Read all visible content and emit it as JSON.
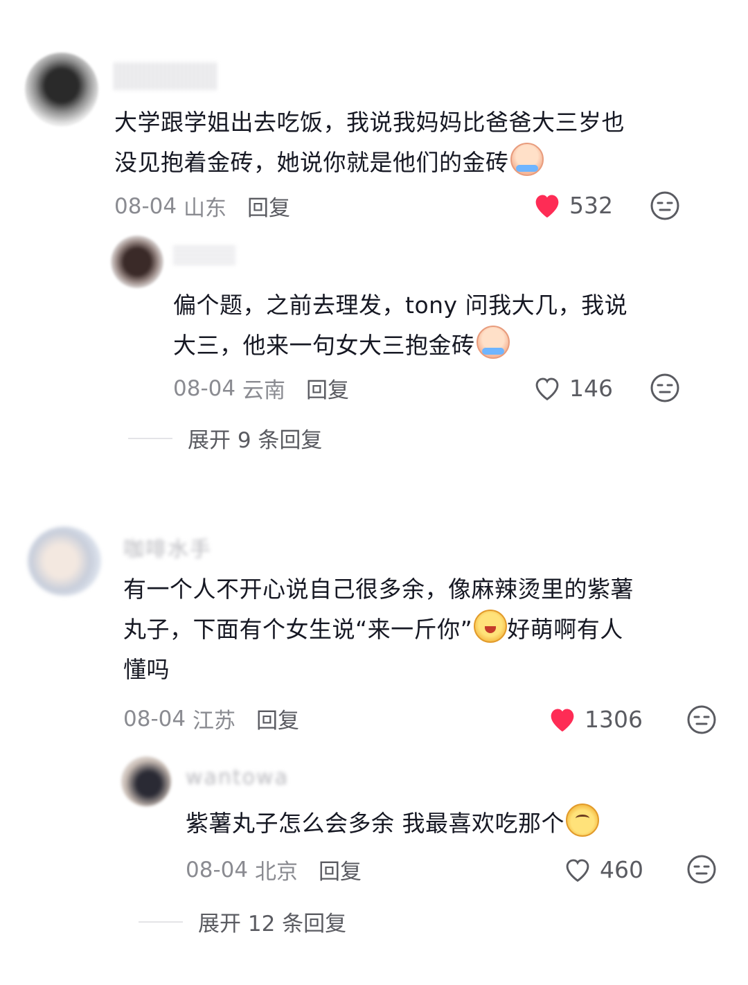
{
  "comments": [
    {
      "text_line1": "大学跟学姐出去吃饭，我说我妈妈比爸爸大三岁也",
      "text_line2": "没见抱着金砖，她说你就是他们的金砖",
      "date": "08-04",
      "location": "山东",
      "reply_label": "回复",
      "likes": "532",
      "liked": true,
      "replies": [
        {
          "text_line1": "偏个题，之前去理发，tony 问我大几，我说",
          "text_line2": "大三，他来一句女大三抱金砖",
          "date": "08-04",
          "location": "云南",
          "reply_label": "回复",
          "likes": "146",
          "liked": false
        }
      ],
      "expand_label": "展开 9 条回复"
    },
    {
      "username": "咖啡水手",
      "text_line1": "有一个人不开心说自己很多余，像麻辣烫里的紫薯",
      "text_line2a": "丸子，下面有个女生说“来一斤你”",
      "text_line2b": "好萌啊有人",
      "text_line3": "懂吗",
      "date": "08-04",
      "location": "江苏",
      "reply_label": "回复",
      "likes": "1306",
      "liked": true,
      "replies": [
        {
          "username": "wantowa",
          "text_line1": "紫薯丸子怎么会多余 我最喜欢吃那个",
          "date": "08-04",
          "location": "北京",
          "reply_label": "回复",
          "likes": "460",
          "liked": false
        }
      ],
      "expand_label": "展开 12 条回复"
    }
  ],
  "colors": {
    "like_red": "#fe2c55",
    "text": "#161823",
    "meta_gray": "#8a8b91"
  }
}
